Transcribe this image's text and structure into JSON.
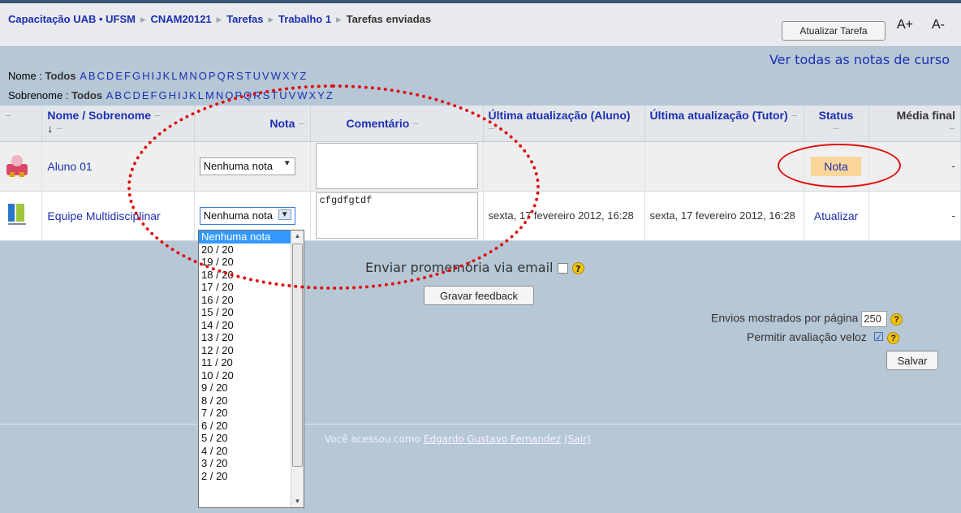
{
  "breadcrumb": {
    "items": [
      "Capacitação UAB • UFSM",
      "CNAM20121",
      "Tarefas",
      "Trabalho 1"
    ],
    "current": "Tarefas enviadas"
  },
  "toolbar": {
    "update_task_label": "Atualizar Tarefa",
    "font_up_label": "A+",
    "font_down_label": "A-"
  },
  "view_all_grades_link": "Ver todas as notas de curso",
  "filters": {
    "first_name_label": "Nome :",
    "last_name_label": "Sobrenome :",
    "all_label": "Todos",
    "letters": [
      "A",
      "B",
      "C",
      "D",
      "E",
      "F",
      "G",
      "H",
      "I",
      "J",
      "K",
      "L",
      "M",
      "N",
      "O",
      "P",
      "Q",
      "R",
      "S",
      "T",
      "U",
      "V",
      "W",
      "X",
      "Y",
      "Z"
    ]
  },
  "table": {
    "headers": {
      "name": "Nome / Sobrenome",
      "sort_arrow": "↓",
      "grade": "Nota",
      "comment": "Comentário",
      "last_update_student": "Última atualização (Aluno)",
      "last_update_tutor": "Última atualização (Tutor)",
      "status": "Status",
      "final_average": "Média final"
    },
    "rows": [
      {
        "name": "Aluno 01",
        "grade": "Nenhuma nota",
        "comment": "",
        "last_update_student": "",
        "last_update_tutor": "",
        "status": "Nota",
        "final_average": "-"
      },
      {
        "name": "Equipe Multidisciplinar",
        "grade": "Nenhuma nota",
        "comment": "cfgdfgtdf",
        "last_update_student": "sexta, 17 fevereiro 2012, 16:28",
        "last_update_tutor": "sexta, 17 fevereiro 2012, 16:28",
        "status": "Atualizar",
        "final_average": "-"
      }
    ]
  },
  "grade_options": [
    "Nenhuma nota",
    "20 / 20",
    "19 / 20",
    "18 / 20",
    "17 / 20",
    "16 / 20",
    "15 / 20",
    "14 / 20",
    "13 / 20",
    "12 / 20",
    "11 / 20",
    "10 / 20",
    "9 / 20",
    "8 / 20",
    "7 / 20",
    "6 / 20",
    "5 / 20",
    "4 / 20",
    "3 / 20",
    "2 / 20"
  ],
  "email_reminder_label": "Enviar promemória via email",
  "save_feedback_label": "Gravar feedback",
  "per_page_label": "Envios mostrados por página",
  "per_page_value": "250",
  "quick_grading_label": "Permitir avaliação veloz",
  "quick_grading_checked": "☑",
  "save_label": "Salvar",
  "footer": {
    "prefix": "Você acessou como",
    "user": "Edgardo Gustavo Fernandez",
    "logout": "(Sair)"
  }
}
